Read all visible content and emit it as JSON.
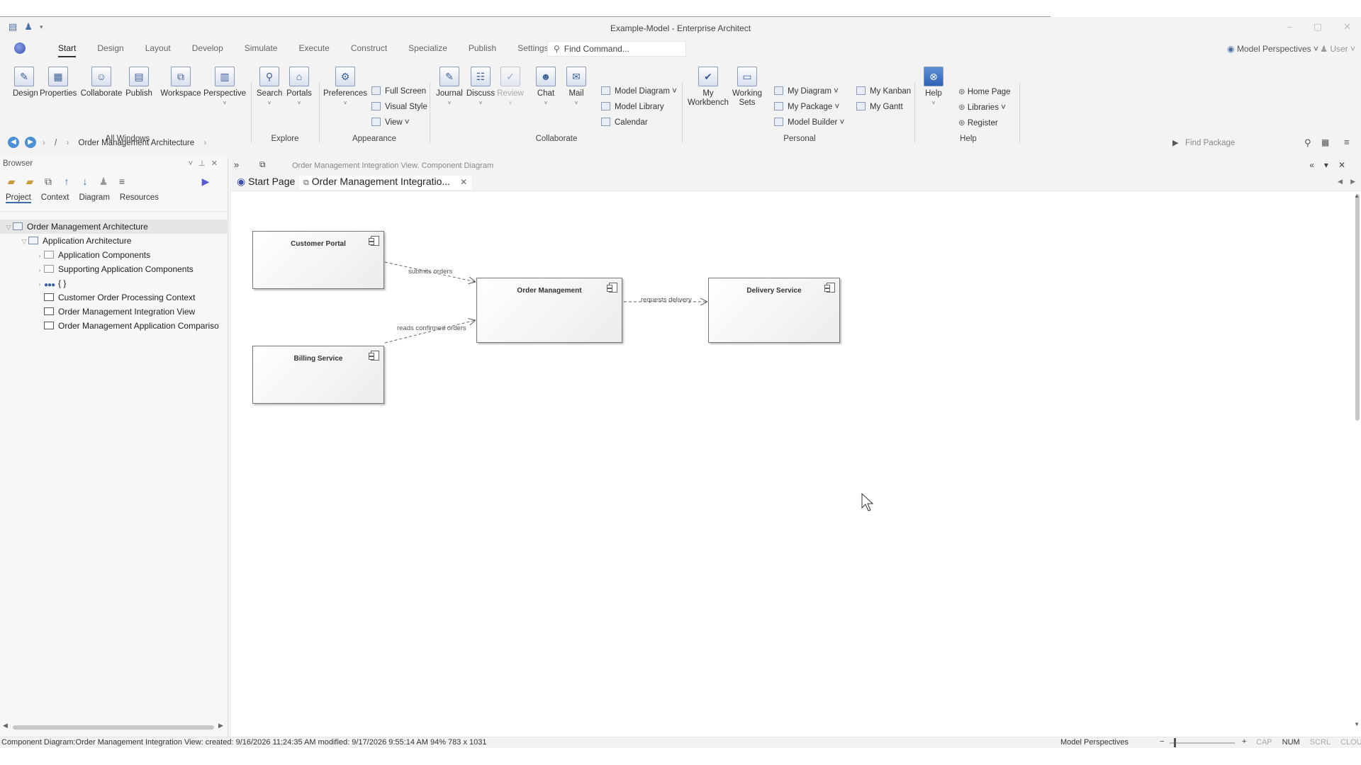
{
  "window": {
    "title": "Example-Model - Enterprise Architect"
  },
  "menu": {
    "tabs": [
      "Start",
      "Design",
      "Layout",
      "Develop",
      "Simulate",
      "Execute",
      "Construct",
      "Specialize",
      "Publish",
      "Settings"
    ],
    "active_tab": "Start",
    "find_command": "Find Command...",
    "model_perspectives": "Model Perspectives",
    "user": "User"
  },
  "ribbon": {
    "all_windows": {
      "label": "All Windows",
      "buttons": [
        "Design",
        "Properties",
        "Collaborate",
        "Publish",
        "Workspace",
        "Perspective"
      ]
    },
    "explore": {
      "label": "Explore",
      "buttons": [
        "Search",
        "Portals"
      ]
    },
    "appearance": {
      "label": "Appearance",
      "preferences": "Preferences",
      "full_screen": "Full Screen",
      "visual_style": "Visual Style",
      "view": "View"
    },
    "collaborate": {
      "label": "Collaborate",
      "buttons": [
        "Journal",
        "Discuss",
        "Review",
        "Chat",
        "Mail"
      ],
      "model_diagram": "Model Diagram",
      "model_library": "Model Library",
      "calendar": "Calendar"
    },
    "personal": {
      "label": "Personal",
      "my_workbench_1": "My",
      "my_workbench_2": "Workbench",
      "working_sets_1": "Working",
      "working_sets_2": "Sets",
      "my_diagram": "My Diagram",
      "my_package": "My Package",
      "model_builder": "Model Builder",
      "my_kanban": "My Kanban",
      "my_gantt": "My Gantt"
    },
    "help": {
      "label": "Help",
      "help": "Help",
      "home_page": "Home Page",
      "libraries": "Libraries",
      "register": "Register"
    }
  },
  "navbar": {
    "root": "/",
    "crumb": "Order Management Architecture",
    "find_package": "Find Package"
  },
  "browser": {
    "title": "Browser",
    "tabs": [
      "Project",
      "Context",
      "Diagram",
      "Resources"
    ],
    "active_tab": "Project",
    "tree": [
      {
        "label": "Order Management Architecture",
        "level": 0,
        "icon": "model-root-icon",
        "expanded": true
      },
      {
        "label": "Application Architecture",
        "level": 1,
        "icon": "package-icon",
        "expanded": true
      },
      {
        "label": "Application Components",
        "level": 2,
        "icon": "folder-icon",
        "expanded": false
      },
      {
        "label": "Supporting Application Components",
        "level": 2,
        "icon": "folder-icon",
        "expanded": false
      },
      {
        "label": "{ }",
        "level": 2,
        "icon": "element-icon",
        "expanded": false
      },
      {
        "label": "Customer Order Processing Context",
        "level": 2,
        "icon": "diagram-icon"
      },
      {
        "label": "Order Management Integration View",
        "level": 2,
        "icon": "diagram-icon"
      },
      {
        "label": "Order Management Application Compariso",
        "level": 2,
        "icon": "diagram-icon"
      }
    ]
  },
  "diagram": {
    "header": "Order Management Integration View.  Component Diagram",
    "tabs": [
      {
        "label": "Start Page"
      },
      {
        "label": "Order Management Integratio..."
      }
    ],
    "components": [
      {
        "name": "Customer Portal"
      },
      {
        "name": "Billing Service"
      },
      {
        "name": "Order Management"
      },
      {
        "name": "Delivery Service"
      }
    ],
    "connectors": [
      {
        "label": "submits orders"
      },
      {
        "label": "reads confirmed orders"
      },
      {
        "label": "requests delivery"
      }
    ]
  },
  "statusbar": {
    "info": "Component Diagram:Order Management Integration View:   created: 9/16/2026 11:24:35 AM   modified: 9/17/2026 9:55:14 AM   94%   783 x 1031",
    "model_perspectives": "Model Perspectives",
    "zoom_fraction": 0.06,
    "indicators": [
      "CAP",
      "NUM",
      "SCRL",
      "CLOUD"
    ],
    "active_indicator": "NUM"
  }
}
